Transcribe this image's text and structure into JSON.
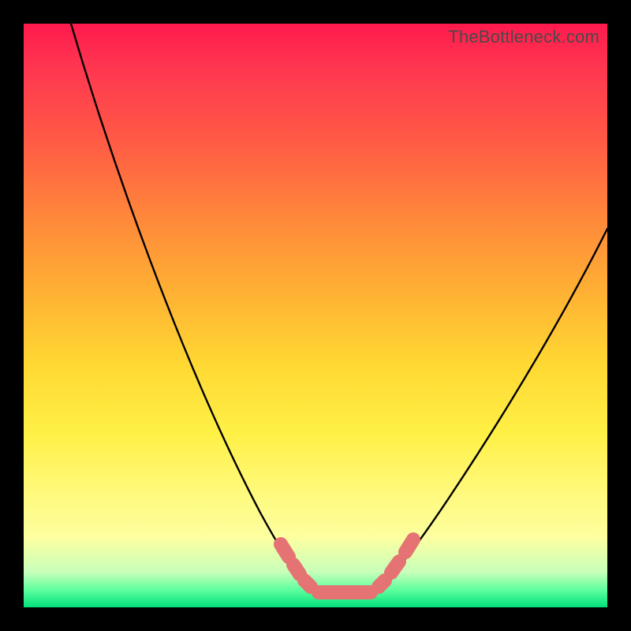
{
  "watermark": "TheBottleneck.com",
  "colors": {
    "frame": "#000000",
    "curve": "#000000",
    "beads": "#e57373",
    "gradient_stops": [
      {
        "pos": 0.0,
        "color": "#ff1a4d"
      },
      {
        "pos": 0.08,
        "color": "#ff3850"
      },
      {
        "pos": 0.2,
        "color": "#ff5a45"
      },
      {
        "pos": 0.34,
        "color": "#ff8a3a"
      },
      {
        "pos": 0.47,
        "color": "#ffb433"
      },
      {
        "pos": 0.58,
        "color": "#ffd733"
      },
      {
        "pos": 0.7,
        "color": "#fff045"
      },
      {
        "pos": 0.8,
        "color": "#fff97a"
      },
      {
        "pos": 0.88,
        "color": "#fdffa0"
      },
      {
        "pos": 0.94,
        "color": "#c7ffba"
      },
      {
        "pos": 0.97,
        "color": "#5fff9e"
      },
      {
        "pos": 1.0,
        "color": "#00e07a"
      }
    ]
  },
  "chart_data": {
    "type": "line",
    "title": "",
    "xlabel": "",
    "ylabel": "",
    "grid": false,
    "x": [
      0.0,
      0.05,
      0.1,
      0.15,
      0.2,
      0.25,
      0.3,
      0.35,
      0.4,
      0.45,
      0.48,
      0.5,
      0.53,
      0.56,
      0.6,
      0.65,
      0.7,
      0.75,
      0.8,
      0.85,
      0.9,
      0.95,
      1.0
    ],
    "y": [
      1.0,
      0.93,
      0.85,
      0.75,
      0.64,
      0.53,
      0.41,
      0.29,
      0.18,
      0.08,
      0.03,
      0.01,
      0.0,
      0.0,
      0.02,
      0.07,
      0.14,
      0.22,
      0.31,
      0.4,
      0.49,
      0.58,
      0.66
    ],
    "xlim": [
      0,
      1
    ],
    "ylim": [
      0,
      1
    ],
    "highlight_beads_x": [
      0.44,
      0.46,
      0.48,
      0.5,
      0.53,
      0.56,
      0.58,
      0.6,
      0.62
    ]
  }
}
